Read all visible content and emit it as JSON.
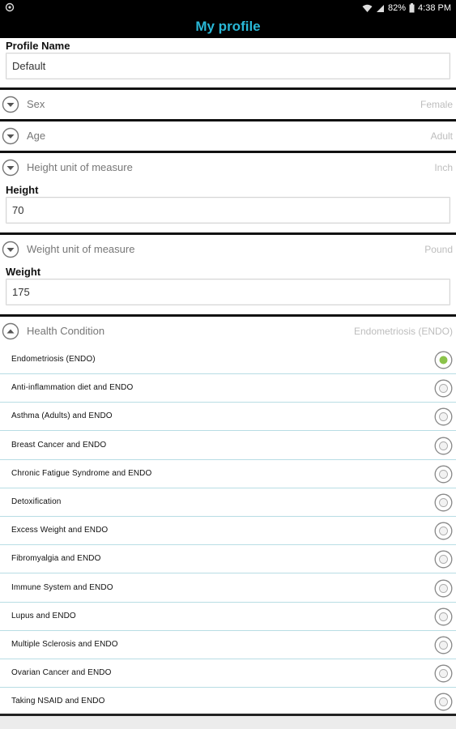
{
  "status_bar": {
    "battery": "82%",
    "time": "4:38 PM"
  },
  "header": {
    "title": "My profile"
  },
  "profile_name": {
    "label": "Profile Name",
    "value": "Default"
  },
  "sex": {
    "label": "Sex",
    "value": "Female"
  },
  "age": {
    "label": "Age",
    "value": "Adult"
  },
  "height_unit": {
    "label": "Height unit of measure",
    "value": "Inch"
  },
  "height": {
    "label": "Height",
    "value": "70"
  },
  "weight_unit": {
    "label": "Weight unit of measure",
    "value": "Pound"
  },
  "weight": {
    "label": "Weight",
    "value": "175"
  },
  "health_condition": {
    "label": "Health Condition",
    "value": "Endometriosis (ENDO)",
    "options": [
      {
        "label": "Endometriosis (ENDO)",
        "selected": true
      },
      {
        "label": "Anti-inflammation diet and ENDO",
        "selected": false
      },
      {
        "label": "Asthma (Adults) and ENDO",
        "selected": false
      },
      {
        "label": "Breast Cancer and ENDO",
        "selected": false
      },
      {
        "label": "Chronic Fatigue Syndrome and ENDO",
        "selected": false
      },
      {
        "label": "Detoxification",
        "selected": false
      },
      {
        "label": "Excess Weight and ENDO",
        "selected": false
      },
      {
        "label": "Fibromyalgia and ENDO",
        "selected": false
      },
      {
        "label": "Immune System and ENDO",
        "selected": false
      },
      {
        "label": "Lupus and ENDO",
        "selected": false
      },
      {
        "label": "Multiple Sclerosis and ENDO",
        "selected": false
      },
      {
        "label": "Ovarian Cancer and ENDO",
        "selected": false
      },
      {
        "label": "Taking NSAID and ENDO",
        "selected": false
      }
    ]
  },
  "colors": {
    "title": "#29b7d6",
    "selected_radio": "#8bc34a",
    "option_divider": "#b8dde4"
  }
}
